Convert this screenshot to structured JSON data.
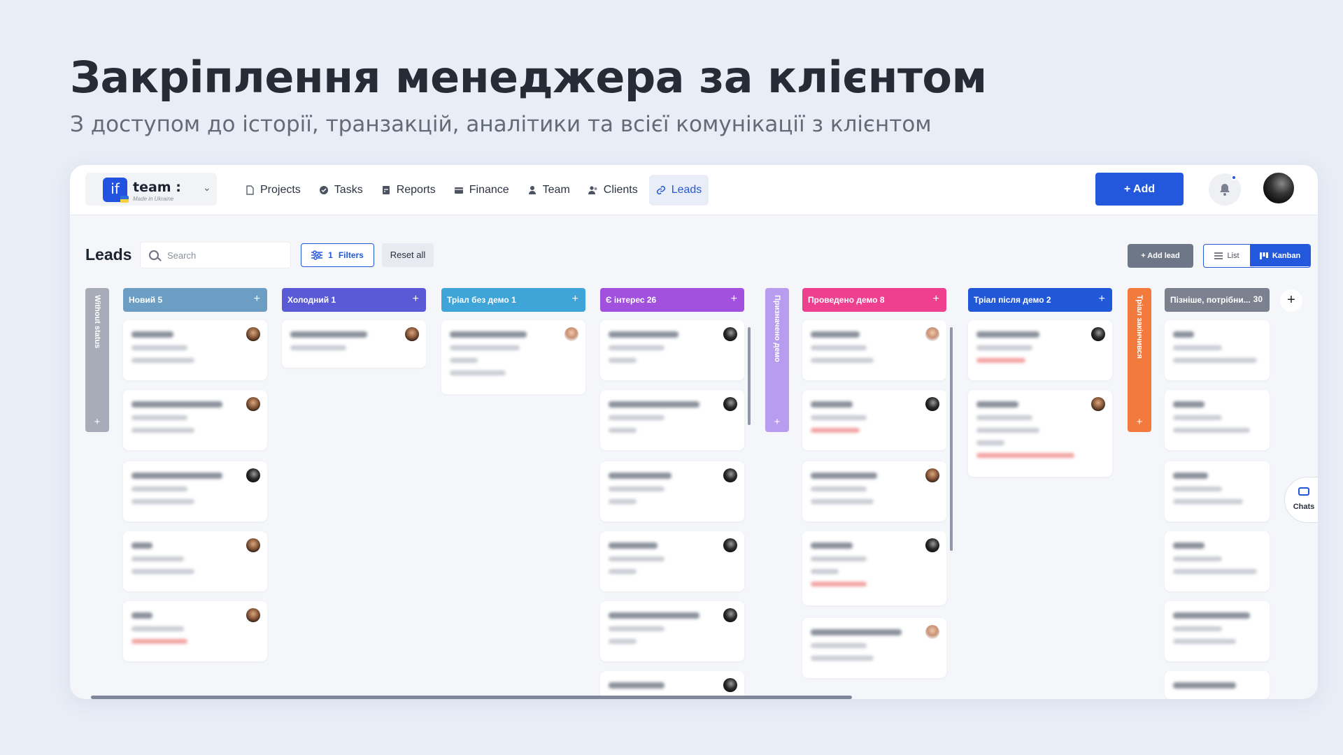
{
  "hero": {
    "title": "Закріплення менеджера за клієнтом",
    "subtitle": "З доступом до історії, транзакцій, аналітики та всієї комунікації з клієнтом"
  },
  "app": {
    "logo": {
      "mark": "if",
      "name": "team :",
      "tagline": "Made in Ukraine"
    },
    "nav": [
      {
        "label": "Projects",
        "icon": "document-icon"
      },
      {
        "label": "Tasks",
        "icon": "check-circle-icon"
      },
      {
        "label": "Reports",
        "icon": "report-icon"
      },
      {
        "label": "Finance",
        "icon": "wallet-icon"
      },
      {
        "label": "Team",
        "icon": "person-icon"
      },
      {
        "label": "Clients",
        "icon": "people-icon"
      },
      {
        "label": "Leads",
        "icon": "link-icon",
        "active": true
      }
    ],
    "add_button": "+ Add",
    "toolbar": {
      "title": "Leads",
      "search_placeholder": "Search",
      "filters_count": "1",
      "filters_label": "Filters",
      "reset_label": "Reset all",
      "add_lead_label": "+ Add lead",
      "view_list": "List",
      "view_kanban": "Kanban"
    },
    "columns": {
      "without_status": "Without status",
      "novyi": {
        "name": "Новий",
        "count": "5"
      },
      "kholodnyi": {
        "name": "Холодний",
        "count": "1"
      },
      "trial_bez_demo": {
        "name": "Тріал без демо",
        "count": "1"
      },
      "interes": {
        "name": "Є інтерес",
        "count": "26"
      },
      "pryznacheno_demo": "Призначено демо",
      "provedeno_demo": {
        "name": "Проведено демо",
        "count": "8"
      },
      "trial_pislia_demo": {
        "name": "Тріал після демо",
        "count": "2"
      },
      "trial_zakinchyvsia": "Тріал закінчився",
      "piznishe": {
        "name": "Пізніше, потрібни...",
        "count": "30"
      }
    },
    "chats_label": "Chats",
    "colors": {
      "novyi": "#6b9ec2",
      "kholodnyi": "#5a5ad6",
      "trial_bez_demo": "#3fa4d8",
      "interes": "#a151dd",
      "pryznacheno": "#b79cf0",
      "provedeno": "#ef3f8f",
      "trial_pislia": "#2058d8",
      "zakinchyvsia": "#f37a3d",
      "piznishe": "#7c8190",
      "without_status": "#a7acb8",
      "accent": "#2358dd"
    }
  }
}
